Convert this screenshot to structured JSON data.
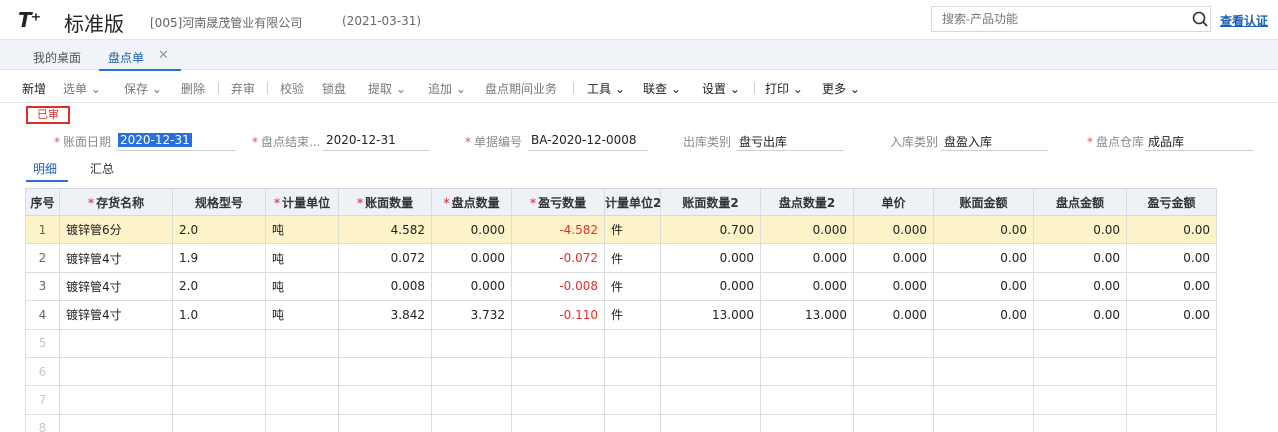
{
  "header": {
    "logo": "T⁺",
    "product": "标准版",
    "company": "[005]河南晟茂管业有限公司",
    "date": "(2021-03-31)",
    "search_placeholder": "搜索-产品功能",
    "auth_link": "查看认证"
  },
  "tabs": {
    "home": "我的桌面",
    "current": "盘点单"
  },
  "toolbar": {
    "new": "新增",
    "select": "选单",
    "save": "保存",
    "delete": "删除",
    "unaudit": "弃审",
    "verify": "校验",
    "lock": "锁盘",
    "extract": "提取",
    "append": "追加",
    "period_business": "盘点期间业务",
    "tools": "工具",
    "query": "联查",
    "settings": "设置",
    "print": "打印",
    "more": "更多"
  },
  "status_stamp": "已审",
  "form": {
    "book_date_label": "账面日期",
    "book_date_value": "2020-12-31",
    "end_label": "盘点结束...",
    "end_value": "2020-12-31",
    "doc_no_label": "单据编号",
    "doc_no_value": "BA-2020-12-0008",
    "out_type_label": "出库类别",
    "out_type_value": "盘亏出库",
    "in_type_label": "入库类别",
    "in_type_value": "盘盈入库",
    "warehouse_label": "盘点仓库",
    "warehouse_value": "成品库"
  },
  "detail_tabs": {
    "detail": "明细",
    "summary": "汇总"
  },
  "table": {
    "columns": {
      "seq": "序号",
      "name": "存货名称",
      "spec": "规格型号",
      "unit": "计量单位",
      "book_qty": "账面数量",
      "count_qty": "盘点数量",
      "diff_qty": "盈亏数量",
      "unit2": "计量单位2",
      "book_qty2": "账面数量2",
      "count_qty2": "盘点数量2",
      "price": "单价",
      "book_amt": "账面金额",
      "count_amt": "盘点金额",
      "diff_amt": "盈亏金额"
    },
    "rows": [
      {
        "seq": "1",
        "name": "镀锌管6分",
        "spec": "2.0",
        "unit": "吨",
        "book_qty": "4.582",
        "count_qty": "0.000",
        "diff_qty": "-4.582",
        "unit2": "件",
        "book_qty2": "0.700",
        "count_qty2": "0.000",
        "price": "0.000",
        "book_amt": "0.00",
        "count_amt": "0.00",
        "diff_amt": "0.00"
      },
      {
        "seq": "2",
        "name": "镀锌管4寸",
        "spec": "1.9",
        "unit": "吨",
        "book_qty": "0.072",
        "count_qty": "0.000",
        "diff_qty": "-0.072",
        "unit2": "件",
        "book_qty2": "0.000",
        "count_qty2": "0.000",
        "price": "0.000",
        "book_amt": "0.00",
        "count_amt": "0.00",
        "diff_amt": "0.00"
      },
      {
        "seq": "3",
        "name": "镀锌管4寸",
        "spec": "2.0",
        "unit": "吨",
        "book_qty": "0.008",
        "count_qty": "0.000",
        "diff_qty": "-0.008",
        "unit2": "件",
        "book_qty2": "0.000",
        "count_qty2": "0.000",
        "price": "0.000",
        "book_amt": "0.00",
        "count_amt": "0.00",
        "diff_amt": "0.00"
      },
      {
        "seq": "4",
        "name": "镀锌管4寸",
        "spec": "1.0",
        "unit": "吨",
        "book_qty": "3.842",
        "count_qty": "3.732",
        "diff_qty": "-0.110",
        "unit2": "件",
        "book_qty2": "13.000",
        "count_qty2": "13.000",
        "price": "0.000",
        "book_amt": "0.00",
        "count_amt": "0.00",
        "diff_amt": "0.00"
      }
    ],
    "empty_row_numbers": [
      "5",
      "6",
      "7",
      "8"
    ]
  },
  "colors": {
    "accent": "#2a6fdb",
    "negative": "#e03030",
    "stamp": "#d93025",
    "selected_row": "#fdf3c8"
  }
}
